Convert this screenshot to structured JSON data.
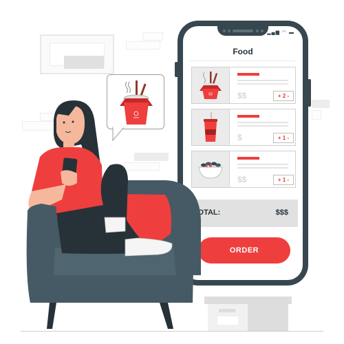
{
  "app": {
    "title": "Food",
    "status_icons": "▂▄▆ ◠ ▬"
  },
  "cart": {
    "items": [
      {
        "icon": "noodle-box-icon",
        "price": "$$",
        "quantity_control": "+ 2 -",
        "quantity": 2
      },
      {
        "icon": "soda-cup-icon",
        "price": "$",
        "quantity_control": "+ 1 -",
        "quantity": 1
      },
      {
        "icon": "salad-bowl-icon",
        "price": "$$",
        "quantity_control": "+ 1 -",
        "quantity": 1
      }
    ],
    "total_label": "TOTAL:",
    "total_value": "$$$"
  },
  "order_button": {
    "label": "ORDER"
  },
  "speech_bubble": {
    "icon": "noodle-box-icon"
  },
  "colors": {
    "accent": "#ef3e3e",
    "phone_frame": "#37474f",
    "armchair": "#455a64",
    "skin": "#f6b89c",
    "hair": "#263238",
    "background": "#ffffff"
  }
}
